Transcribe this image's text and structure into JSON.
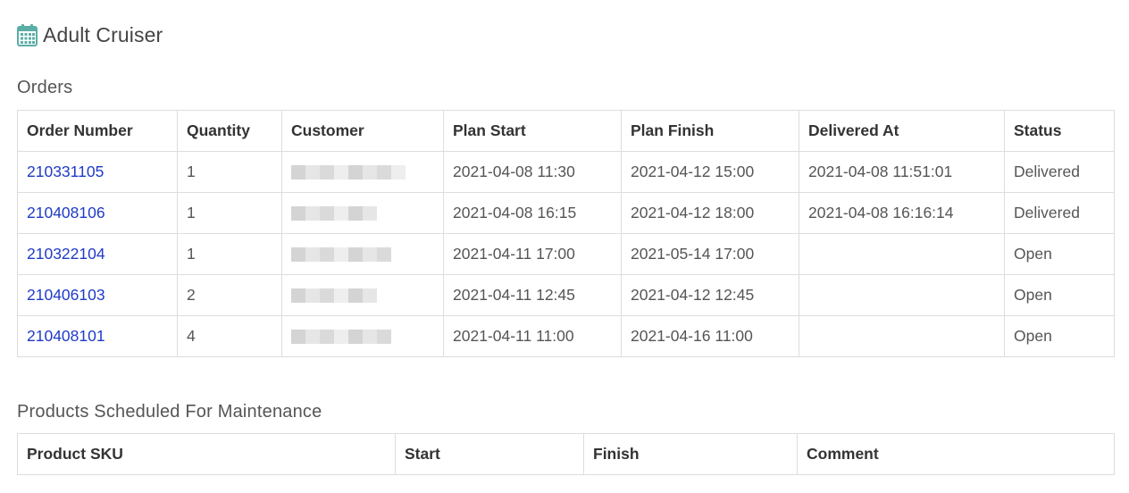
{
  "page": {
    "icon": "calendar-icon",
    "title": "Adult Cruiser"
  },
  "orders": {
    "title": "Orders",
    "columns": [
      "Order Number",
      "Quantity",
      "Customer",
      "Plan Start",
      "Plan Finish",
      "Delivered At",
      "Status"
    ],
    "rows": [
      {
        "order_number": "210331105",
        "quantity": "1",
        "plan_start": "2021-04-08 11:30",
        "plan_finish": "2021-04-12 15:00",
        "delivered_at": "2021-04-08 11:51:01",
        "status": "Delivered"
      },
      {
        "order_number": "210408106",
        "quantity": "1",
        "plan_start": "2021-04-08 16:15",
        "plan_finish": "2021-04-12 18:00",
        "delivered_at": "2021-04-08 16:16:14",
        "status": "Delivered"
      },
      {
        "order_number": "210322104",
        "quantity": "1",
        "plan_start": "2021-04-11 17:00",
        "plan_finish": "2021-05-14 17:00",
        "delivered_at": "",
        "status": "Open"
      },
      {
        "order_number": "210406103",
        "quantity": "2",
        "plan_start": "2021-04-11 12:45",
        "plan_finish": "2021-04-12 12:45",
        "delivered_at": "",
        "status": "Open"
      },
      {
        "order_number": "210408101",
        "quantity": "4",
        "plan_start": "2021-04-11 11:00",
        "plan_finish": "2021-04-16 11:00",
        "delivered_at": "",
        "status": "Open"
      }
    ]
  },
  "maintenance": {
    "title": "Products Scheduled For Maintenance",
    "columns": [
      "Product SKU",
      "Start",
      "Finish",
      "Comment"
    ]
  },
  "colors": {
    "link": "#1f3ac8",
    "icon_teal": "#5aaea6",
    "border": "#dddddd"
  }
}
